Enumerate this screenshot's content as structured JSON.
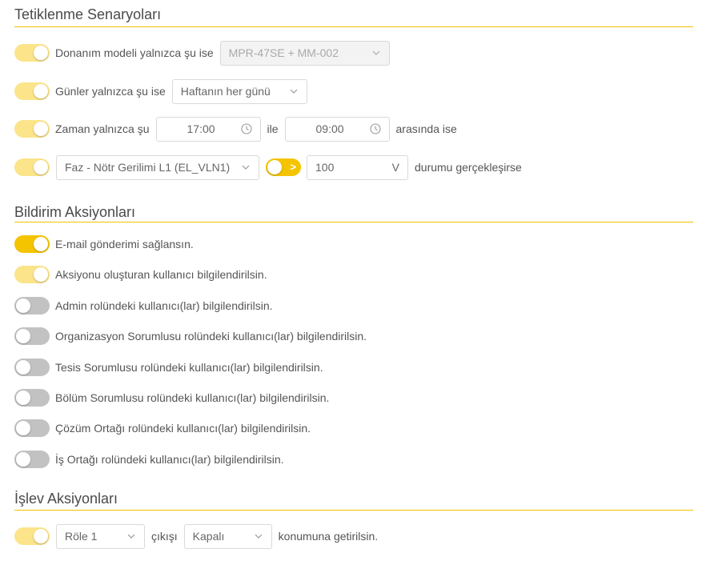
{
  "triggers": {
    "title": "Tetiklenme Senaryoları",
    "hardware": {
      "label": "Donanım modeli yalnızca şu ise",
      "value": "MPR-47SE + MM-002"
    },
    "days": {
      "label": "Günler yalnızca şu ise",
      "value": "Haftanın her günü"
    },
    "time": {
      "label": "Zaman yalnızca şu",
      "start": "17:00",
      "connector": "ile",
      "end": "09:00",
      "suffix": "arasında ise"
    },
    "condition": {
      "parameter": "Faz - Nötr Gerilimi L1 (EL_VLN1)",
      "value": "100",
      "unit": "V",
      "suffix": "durumu gerçekleşirse"
    }
  },
  "notifications": {
    "title": "Bildirim Aksiyonları",
    "items": [
      {
        "label": "E-mail gönderimi sağlansın.",
        "state": "on"
      },
      {
        "label": "Aksiyonu oluşturan kullanıcı bilgilendirilsin.",
        "state": "on-light"
      },
      {
        "label": "Admin rolündeki kullanıcı(lar) bilgilendirilsin.",
        "state": "off"
      },
      {
        "label": "Organizasyon Sorumlusu rolündeki kullanıcı(lar) bilgilendirilsin.",
        "state": "off"
      },
      {
        "label": "Tesis Sorumlusu rolündeki kullanıcı(lar) bilgilendirilsin.",
        "state": "off"
      },
      {
        "label": "Bölüm Sorumlusu rolündeki kullanıcı(lar) bilgilendirilsin.",
        "state": "off"
      },
      {
        "label": "Çözüm Ortağı rolündeki kullanıcı(lar) bilgilendirilsin.",
        "state": "off"
      },
      {
        "label": "İş Ortağı rolündeki kullanıcı(lar) bilgilendirilsin.",
        "state": "off"
      }
    ]
  },
  "functions": {
    "title": "İşlev Aksiyonları",
    "relay": "Röle 1",
    "connector": "çıkışı",
    "position": "Kapalı",
    "suffix": "konumuna getirilsin."
  },
  "colors": {
    "accent": "#f5c400",
    "accent_light": "#fbe48a",
    "off": "#c2c2c2",
    "divider": "#f2c200"
  }
}
